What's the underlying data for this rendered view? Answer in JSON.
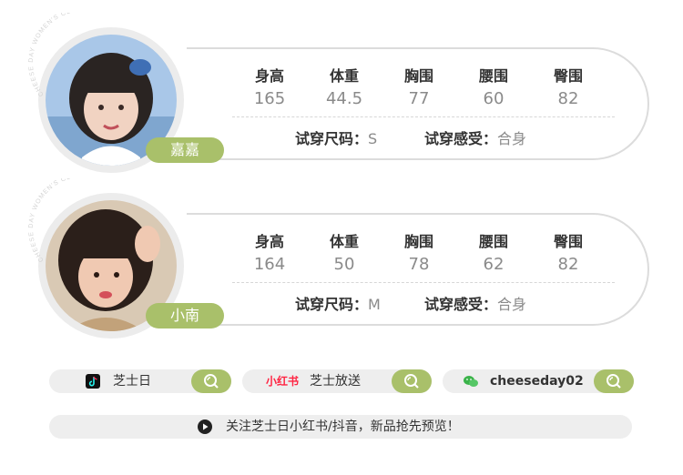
{
  "stat_labels": [
    "身高",
    "体重",
    "胸围",
    "腰围",
    "臀围"
  ],
  "models": [
    {
      "name": "嘉嘉",
      "values": [
        "165",
        "44.5",
        "77",
        "60",
        "82"
      ],
      "size_label": "试穿尺码：",
      "size_value": "S",
      "feel_label": "试穿感受：",
      "feel_value": "合身"
    },
    {
      "name": "小南",
      "values": [
        "164",
        "50",
        "78",
        "62",
        "82"
      ],
      "size_label": "试穿尺码：",
      "size_value": "M",
      "feel_label": "试穿感受：",
      "feel_value": "合身"
    }
  ],
  "brand_watermark": "CHEESE DAY WOMEN'S CLOTHING",
  "social": [
    {
      "platform_icon": "douyin-icon",
      "label": "芝士日"
    },
    {
      "platform_icon": "xiaohongshu-logo",
      "logo_text": "小红书",
      "label": "芝士放送"
    },
    {
      "platform_icon": "wechat-icon",
      "label": "cheeseday02"
    }
  ],
  "footer": "关注芝士日小红书/抖音，新品抢先预览！",
  "colors": {
    "accent": "#a9c06a",
    "pill_bg": "#eeeeee",
    "xhs_red": "#ff2442"
  }
}
